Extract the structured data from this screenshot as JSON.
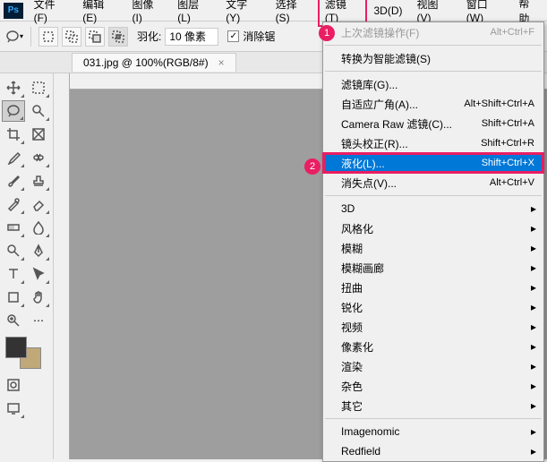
{
  "menubar": {
    "items": [
      "文件(F)",
      "编辑(E)",
      "图像(I)",
      "图层(L)",
      "文字(Y)",
      "选择(S)",
      "滤镜(T)",
      "3D(D)",
      "视图(V)",
      "窗口(W)",
      "帮助"
    ],
    "active_index": 6
  },
  "options": {
    "feather_label": "羽化:",
    "feather_value": "10 像素",
    "antialias_label": "消除锯"
  },
  "tab": {
    "title": "031.jpg @ 100%(RGB/8#)"
  },
  "dropdown": {
    "last_filter": "上次滤镜操作(F)",
    "last_filter_sc": "Alt+Ctrl+F",
    "smart": "转换为智能滤镜(S)",
    "gallery": "滤镜库(G)...",
    "adaptive": "自适应广角(A)...",
    "adaptive_sc": "Alt+Shift+Ctrl+A",
    "cameraraw": "Camera Raw 滤镜(C)...",
    "cameraraw_sc": "Shift+Ctrl+A",
    "lens": "镜头校正(R)...",
    "lens_sc": "Shift+Ctrl+R",
    "liquify": "液化(L)...",
    "liquify_sc": "Shift+Ctrl+X",
    "vanish": "消失点(V)...",
    "vanish_sc": "Alt+Ctrl+V",
    "sub": [
      "3D",
      "风格化",
      "模糊",
      "模糊画廊",
      "扭曲",
      "锐化",
      "视频",
      "像素化",
      "渲染",
      "杂色",
      "其它"
    ],
    "plugins": [
      "Imagenomic",
      "Redfield"
    ]
  },
  "markers": {
    "one": "1",
    "two": "2"
  }
}
